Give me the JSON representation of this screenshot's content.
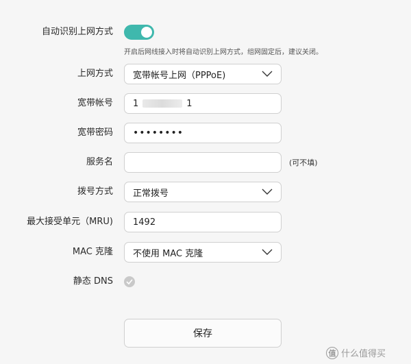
{
  "auto_detect": {
    "label": "自动识别上网方式",
    "enabled": true,
    "hint": "开启后网线接入时将自动识别上网方式，组网固定后，建议关闭。"
  },
  "connection_type": {
    "label": "上网方式",
    "value": "宽带帐号上网（PPPoE)"
  },
  "account": {
    "label": "宽带帐号",
    "value_start": "1",
    "value_end": "1"
  },
  "password": {
    "label": "宽带密码",
    "value": "••••••••"
  },
  "service_name": {
    "label": "服务名",
    "value": "",
    "note": "(可不填)"
  },
  "dial_mode": {
    "label": "拨号方式",
    "value": "正常拨号"
  },
  "mru": {
    "label": "最大接受单元（MRU)",
    "value": "1492"
  },
  "mac_clone": {
    "label": "MAC 克隆",
    "value": "不使用 MAC 克隆"
  },
  "static_dns": {
    "label": "静态 DNS",
    "checked": false
  },
  "save_button": {
    "label": "保存"
  },
  "watermark": {
    "logo": "值",
    "text": "什么值得买"
  },
  "colors": {
    "toggle_on": "#3fb8ad",
    "background": "#f6f6f6"
  }
}
